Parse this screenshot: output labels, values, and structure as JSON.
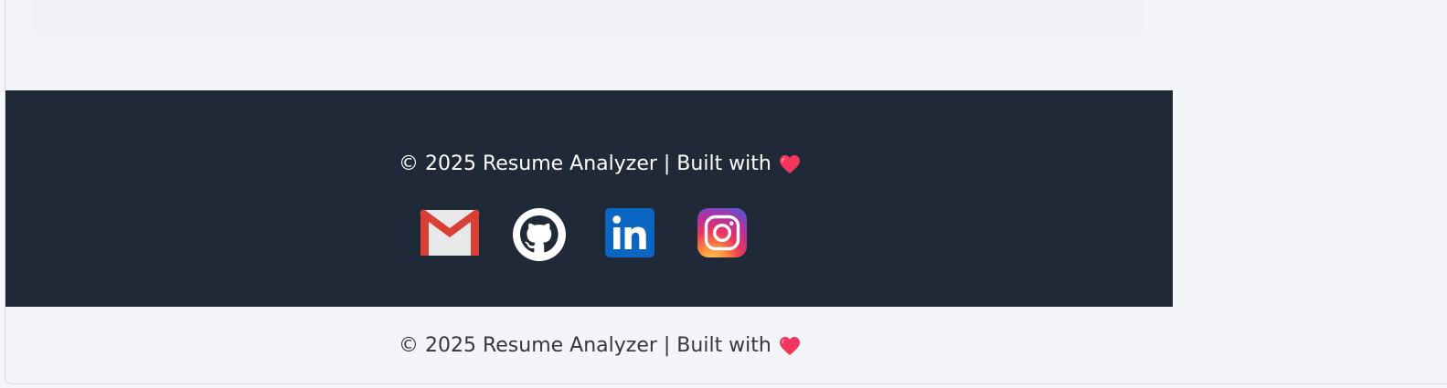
{
  "footer": {
    "copyright": "© 2025 Resume Analyzer | Built with",
    "heart_icon": "heart-icon",
    "social_links": [
      {
        "name": "gmail",
        "icon": "gmail-icon"
      },
      {
        "name": "github",
        "icon": "github-icon"
      },
      {
        "name": "linkedin",
        "icon": "linkedin-icon"
      },
      {
        "name": "instagram",
        "icon": "instagram-icon"
      }
    ]
  },
  "bottom": {
    "copyright": "© 2025 Resume Analyzer | Built with"
  },
  "colors": {
    "footer_bg": "#202938",
    "page_bg": "#f4f5f8",
    "heart": "#f5365c",
    "linkedin": "#0a66c2"
  }
}
